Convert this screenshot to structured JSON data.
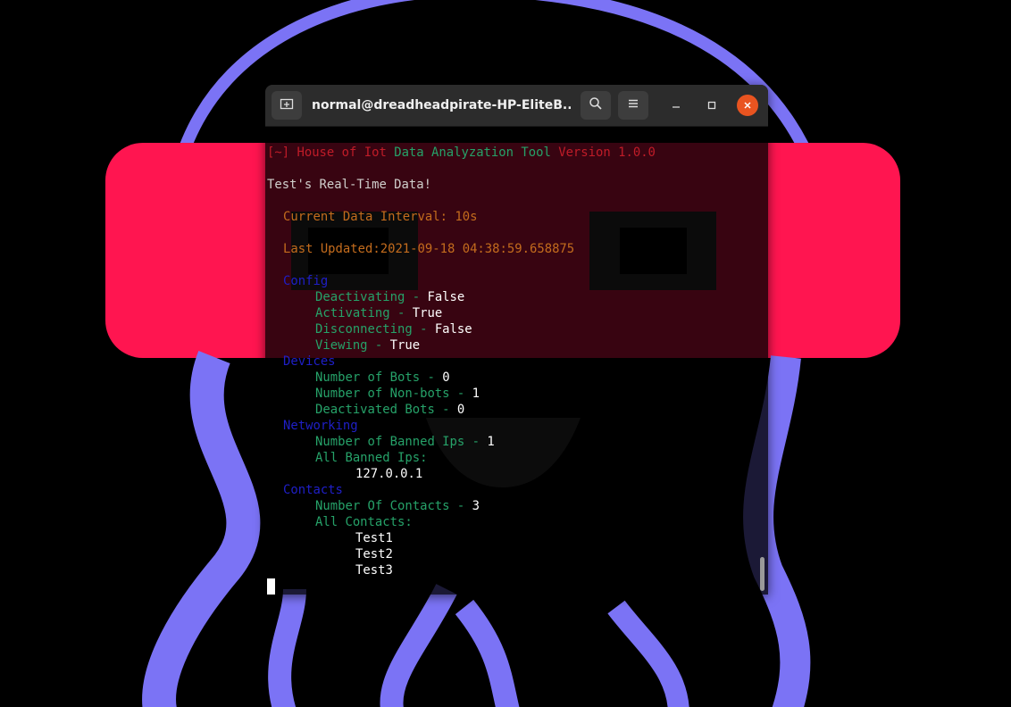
{
  "window": {
    "title": "normal@dreadheadpirate-HP-EliteB...",
    "buttons": {
      "new_tab_icon": "new-tab-icon",
      "search_icon": "search-icon",
      "menu_icon": "hamburger-menu-icon",
      "minimize_icon": "minimize-icon",
      "maximize_icon": "maximize-icon",
      "close_icon": "close-icon"
    }
  },
  "terminal": {
    "header": {
      "prefix": "[~]",
      "name": "House of Iot",
      "tool": "Data Analyzation Tool",
      "version": "Version 1.0.0"
    },
    "subtitle": "Test's Real-Time Data!",
    "interval_label": "Current Data Interval: 10s",
    "updated_label": "Last Updated:2021-09-18 04:38:59.658875",
    "sections": {
      "config": {
        "title": "Config",
        "deactivating": {
          "key": "Deactivating",
          "value": "False"
        },
        "activating": {
          "key": "Activating",
          "value": "True"
        },
        "disconnecting": {
          "key": "Disconnecting",
          "value": "False"
        },
        "viewing": {
          "key": "Viewing",
          "value": "True"
        }
      },
      "devices": {
        "title": "Devices",
        "bots": {
          "key": "Number of Bots",
          "value": "0"
        },
        "non_bots": {
          "key": "Number of Non-bots",
          "value": "1"
        },
        "deactivated": {
          "key": "Deactivated Bots",
          "value": "0"
        }
      },
      "networking": {
        "title": "Networking",
        "banned_count": {
          "key": "Number of Banned Ips",
          "value": "1"
        },
        "all_banned_label": "All Banned Ips:",
        "banned_ips": [
          "127.0.0.1"
        ]
      },
      "contacts": {
        "title": "Contacts",
        "count": {
          "key": "Number Of Contacts",
          "value": "3"
        },
        "all_label": "All Contacts:",
        "items": [
          "Test1",
          "Test2",
          "Test3"
        ]
      }
    },
    "separator": " - "
  },
  "colors": {
    "terminal_red": "#c01c28",
    "terminal_green": "#26a269",
    "terminal_orange": "#c46c1d",
    "terminal_blue": "#1f1fc8",
    "close_button": "#e95420",
    "wallpaper_purple": "#7b73f5",
    "wallpaper_pink": "#ff1550"
  }
}
